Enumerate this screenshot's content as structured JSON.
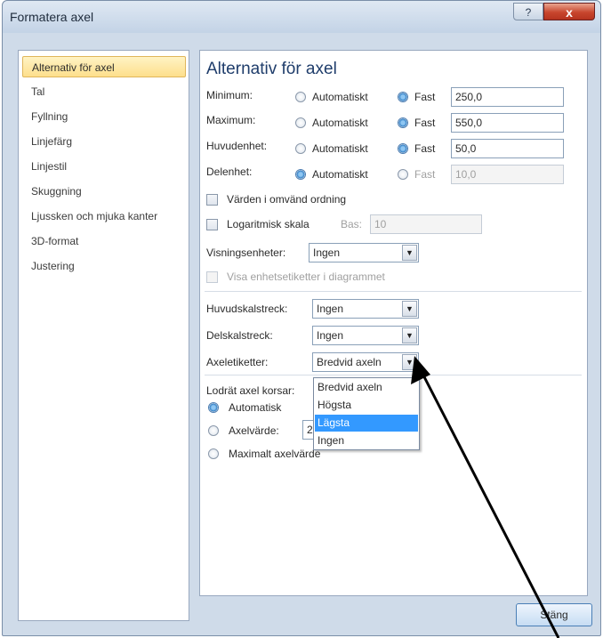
{
  "window": {
    "title": "Formatera axel",
    "help_glyph": "?",
    "close_glyph": "x"
  },
  "sidebar": {
    "items": [
      {
        "label": "Alternativ för axel",
        "selected": true
      },
      {
        "label": "Tal"
      },
      {
        "label": "Fyllning"
      },
      {
        "label": "Linjefärg"
      },
      {
        "label": "Linjestil"
      },
      {
        "label": "Skuggning"
      },
      {
        "label": "Ljussken och mjuka kanter"
      },
      {
        "label": "3D-format"
      },
      {
        "label": "Justering"
      }
    ]
  },
  "main": {
    "heading": "Alternativ för axel",
    "rows": [
      {
        "label": "Minimum:",
        "auto_label": "Automatiskt",
        "fixed_label": "Fast",
        "value": "250,0",
        "selected": "fixed"
      },
      {
        "label": "Maximum:",
        "auto_label": "Automatiskt",
        "fixed_label": "Fast",
        "value": "550,0",
        "selected": "fixed"
      },
      {
        "label": "Huvudenhet:",
        "auto_label": "Automatiskt",
        "fixed_label": "Fast",
        "value": "50,0",
        "selected": "fixed"
      },
      {
        "label": "Delenhet:",
        "auto_label": "Automatiskt",
        "fixed_label": "Fast",
        "value": "10,0",
        "selected": "auto"
      }
    ],
    "reverse_order_label": "Värden i omvänd ordning",
    "log_scale_label": "Logaritmisk skala",
    "base_label": "Bas:",
    "base_value": "10",
    "display_units_label": "Visningsenheter:",
    "display_units_value": "Ingen",
    "show_units_label": "Visa enhetsetiketter i diagrammet",
    "major_tick_label": "Huvudskalstreck:",
    "major_tick_value": "Ingen",
    "minor_tick_label": "Delskalstreck:",
    "minor_tick_value": "Ingen",
    "axis_labels_label": "Axeletiketter:",
    "axis_labels_value": "Bredvid axeln",
    "crosses_label": "Lodrät axel korsar:",
    "crosses_auto_label": "Automatisk",
    "crosses_value_label": "Axelvärde:",
    "crosses_value": "2",
    "crosses_max_label": "Maximalt axelvärde"
  },
  "dropdown": {
    "options": [
      "Bredvid axeln",
      "Högsta",
      "Lägsta",
      "Ingen"
    ],
    "highlighted": "Lägsta"
  },
  "footer": {
    "close_label": "Stäng"
  }
}
